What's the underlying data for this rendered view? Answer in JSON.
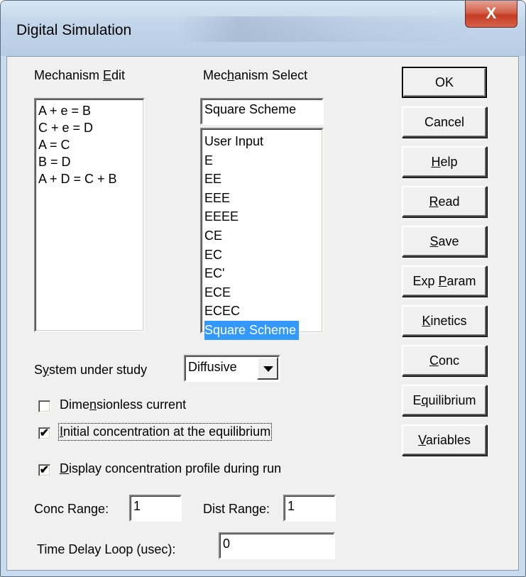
{
  "window": {
    "title": "Digital Simulation",
    "close_glyph": "X"
  },
  "mechanism_edit": {
    "label_pre": "Mechanism ",
    "label_key": "E",
    "label_post": "dit",
    "lines": [
      "A + e = B",
      "C + e = D",
      "A = C",
      "B = D",
      "A + D = C + B"
    ]
  },
  "mechanism_select": {
    "label_pre": "Mec",
    "label_key": "h",
    "label_post": "anism Select",
    "current": "Square Scheme",
    "options": [
      "User Input",
      "E",
      "EE",
      "EEE",
      "EEEE",
      "CE",
      "EC",
      "EC'",
      "ECE",
      "ECEC",
      "Square Scheme"
    ],
    "selected_index": 10
  },
  "system": {
    "label_pre": "S",
    "label_key": "y",
    "label_post": "stem under study",
    "value": "Diffusive"
  },
  "checkboxes": {
    "dimensionless": {
      "pre": "Dime",
      "key": "n",
      "post": "sionless current",
      "checked": false
    },
    "initial_conc": {
      "pre": "",
      "key": "I",
      "post": "nitial concentration at the equilibrium",
      "checked": true
    },
    "display_profile": {
      "pre": "",
      "key": "D",
      "post": "isplay concentration profile during run",
      "checked": true
    }
  },
  "fields": {
    "conc_range_label": "Conc Range:",
    "conc_range_value": "1",
    "dist_range_label": "Dist Range:",
    "dist_range_value": "1",
    "time_delay_label": "Time Delay Loop (usec):",
    "time_delay_value": "0"
  },
  "buttons": [
    {
      "pre": "OK",
      "key": "",
      "post": ""
    },
    {
      "pre": "Cancel",
      "key": "",
      "post": ""
    },
    {
      "pre": "",
      "key": "H",
      "post": "elp"
    },
    {
      "pre": "",
      "key": "R",
      "post": "ead"
    },
    {
      "pre": "",
      "key": "S",
      "post": "ave"
    },
    {
      "pre": "Exp ",
      "key": "P",
      "post": "aram"
    },
    {
      "pre": "",
      "key": "K",
      "post": "inetics"
    },
    {
      "pre": "",
      "key": "C",
      "post": "onc"
    },
    {
      "pre": "E",
      "key": "q",
      "post": "uilibrium"
    },
    {
      "pre": "",
      "key": "V",
      "post": "ariables"
    }
  ],
  "checkmark_glyph": "✔"
}
